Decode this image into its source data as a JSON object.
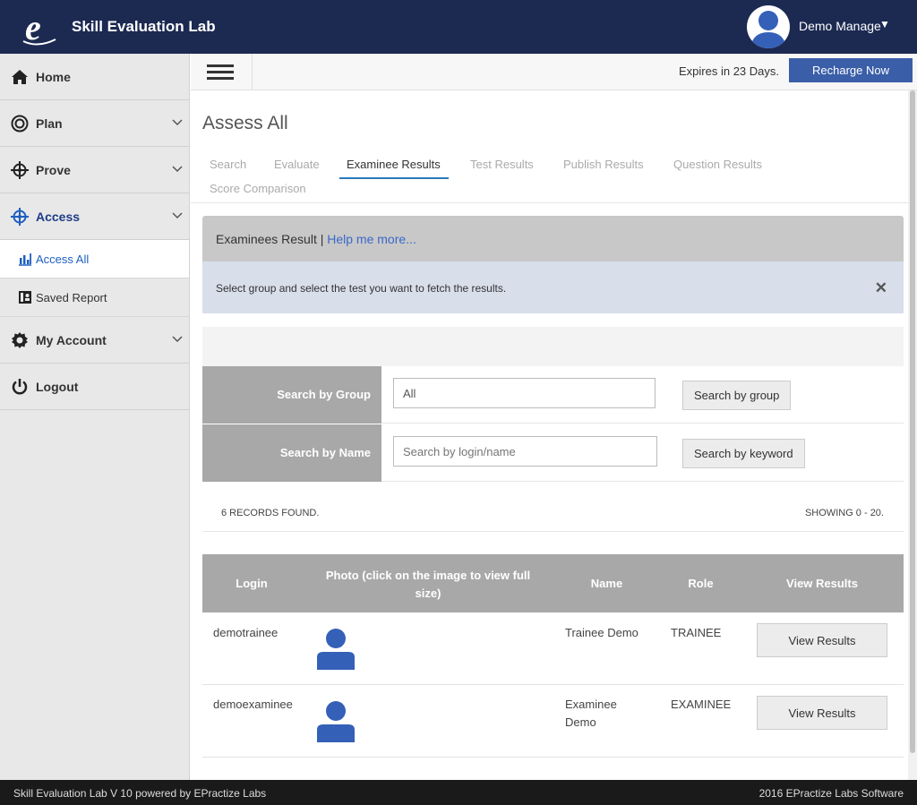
{
  "header": {
    "app_title": "Skill Evaluation Lab",
    "user_name": "Demo Manage",
    "user_caret": "▼"
  },
  "sidebar": {
    "items": [
      {
        "label": "Home",
        "icon": "home-icon"
      },
      {
        "label": "Plan",
        "icon": "target-ring-icon"
      },
      {
        "label": "Prove",
        "icon": "crosshair-icon"
      },
      {
        "label": "Access",
        "icon": "crosshair-icon"
      },
      {
        "label": "My Account",
        "icon": "gear-icon"
      },
      {
        "label": "Logout",
        "icon": "power-icon"
      }
    ],
    "sub_items": [
      {
        "label": "Access All",
        "icon": "bar-chart-icon"
      },
      {
        "label": "Saved Report",
        "icon": "report-icon"
      }
    ]
  },
  "strip": {
    "expires": "Expires in 23 Days.",
    "recharge": "Recharge Now"
  },
  "page": {
    "title": "Assess All",
    "tabs": [
      "Search",
      "Evaluate",
      "Examinee Results",
      "Test Results",
      "Publish Results",
      "Question Results",
      "Score Comparison"
    ],
    "active_tab": "Examinee Results"
  },
  "panel": {
    "title": "Examinees Result |",
    "help_link": " Help me more...",
    "info": "Select group and select the test you want to fetch the results.",
    "close": "✕"
  },
  "search": {
    "group_label": "Search by Group",
    "group_value": "All",
    "group_button": "Search by group",
    "name_label": "Search by Name",
    "name_placeholder": "Search by login/name",
    "name_button": "Search by keyword"
  },
  "records": {
    "found": "6 RECORDS FOUND.",
    "showing": "SHOWING 0 - 20."
  },
  "table": {
    "headers": [
      "Login",
      "Photo (click on the image to view full size)",
      "Name",
      "Role",
      "View Results"
    ],
    "rows": [
      {
        "login": "demotrainee",
        "name": "Trainee Demo",
        "role": "TRAINEE",
        "action": "View Results"
      },
      {
        "login": "demoexaminee",
        "name": "Examinee Demo",
        "role": "EXAMINEE",
        "action": "View Results"
      }
    ]
  },
  "footer": {
    "left": "Skill Evaluation Lab V 10 powered by EPractize Labs",
    "right": "2016 EPractize Labs Software"
  },
  "colors": {
    "topbar": "#1c2a52",
    "accent": "#3a5ea8",
    "avatar": "#3560b8",
    "table_header": "#a8a8a8"
  }
}
